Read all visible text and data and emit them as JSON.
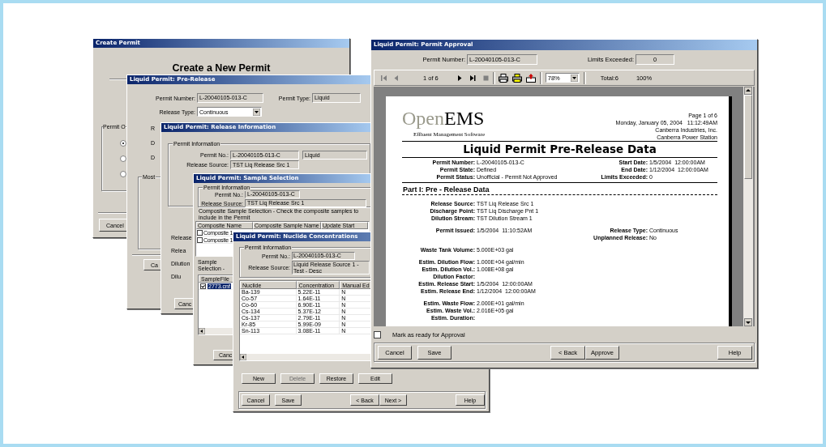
{
  "windows": [
    {
      "kind": "create",
      "title": "Create Permit",
      "heading": "Create a New Permit",
      "group_label": "Permit O",
      "options": [
        {
          "selected": true
        },
        {
          "selected": false
        },
        {
          "selected": false
        }
      ],
      "buttons": [
        "Cancel"
      ]
    },
    {
      "kind": "prerelease",
      "title": "Liquid Permit: Pre-Release",
      "fields": [
        {
          "label": "Permit Number:",
          "value": "L-20040105-013-C"
        },
        {
          "label": "Permit Type:",
          "value": "Liquid"
        }
      ],
      "release_type": {
        "label": "Release Type:",
        "value": "Continuous"
      },
      "labels": [
        "R",
        "D",
        "D"
      ],
      "group_label": "Most",
      "buttons": [
        "Ca"
      ]
    },
    {
      "kind": "release_info",
      "title": "Liquid Permit: Release Information",
      "group_label": "Permit Information",
      "fields": [
        {
          "label": "Permit No.:",
          "values": [
            "L-20040105-013-C",
            "Liquid"
          ]
        },
        {
          "label": "Release Source:",
          "values": [
            "TST Liq Release Src 1"
          ]
        }
      ],
      "labels": [
        "Release",
        "Relea",
        "Dilution",
        "Dilu"
      ],
      "buttons": [
        "Canc"
      ]
    },
    {
      "kind": "sample_selection",
      "title": "Liquid Permit: Sample Selection",
      "group_label": "Permit Information",
      "fields": [
        {
          "label": "Permit No.:",
          "values": [
            "L-20040105-013-C"
          ]
        },
        {
          "label": "Release Source:",
          "values": [
            "TST Liq Release Src 1"
          ]
        }
      ],
      "instruction": "Composite Sample Selection - Check the composite samples to include in the Permit",
      "composite_columns": [
        "Composite Name",
        "Composite Sample Name",
        "Update Start"
      ],
      "composite_rows": [
        {
          "checked": false,
          "name": "Composite 1"
        },
        {
          "checked": false,
          "name": "Composite 1"
        }
      ],
      "sample_label": "Sample Selection -",
      "sample_columns": [
        "SampleFile"
      ],
      "sample_rows": [
        {
          "checked": true,
          "selected": true,
          "name": "2773.cnf"
        }
      ],
      "buttons": [
        "Canc"
      ]
    },
    {
      "kind": "nuclides",
      "title": "Liquid Permit: Nuclide Concentrations",
      "group_label": "Permit Information",
      "fields": [
        {
          "label": "Permit No.:",
          "values": [
            "L-20040105-013-C"
          ]
        },
        {
          "label": "Release Source:",
          "values": [
            "Liquid Release Source 1 - Test - Desc"
          ]
        }
      ],
      "columns": [
        "Nuclide",
        "Concentration",
        "Manual Ed"
      ],
      "rows": [
        [
          "Ba-139",
          "5.22E-11",
          "N"
        ],
        [
          "Co-57",
          "1.64E-11",
          "N"
        ],
        [
          "Co-60",
          "6.90E-11",
          "N"
        ],
        [
          "Cs-134",
          "5.37E-12",
          "N"
        ],
        [
          "Cs-137",
          "2.79E-11",
          "N"
        ],
        [
          "Kr-85",
          "5.99E-09",
          "N"
        ],
        [
          "Sn-113",
          "3.08E-11",
          "N"
        ]
      ],
      "actions": [
        {
          "label": "New",
          "disabled": false
        },
        {
          "label": "Delete",
          "disabled": true
        },
        {
          "label": "Restore",
          "disabled": false
        },
        {
          "label": "Edit",
          "disabled": false
        }
      ],
      "nav_buttons": [
        "Cancel",
        "Save",
        "< Back",
        "Next >",
        "Help"
      ]
    },
    {
      "kind": "approval",
      "title": "Liquid Permit: Permit Approval",
      "permit_number": {
        "label": "Permit Number:",
        "value": "L-20040105-013-C"
      },
      "limits_exceeded": {
        "label": "Limits Exceeded:",
        "value": "0"
      },
      "toolbar": {
        "page": "1 of 6",
        "zoom": "78%",
        "total": "Total:6",
        "percent": "100%"
      },
      "report": {
        "logo": {
          "light": "Open",
          "dark": "EMS",
          "tagline": "Effluent Management Software"
        },
        "header_lines": [
          "Page 1 of 6",
          "Monday, January 05, 2004   11:12:49AM",
          "Canberra Industries, Inc.",
          "Canberra Power Station"
        ],
        "title": "Liquid Permit Pre-Release Data",
        "info": [
          {
            "left": {
              "label": "Permit Number:",
              "value": "L-20040105-013-C"
            },
            "right": {
              "label": "Start Date:",
              "value": "1/5/2004  12:00:00AM"
            }
          },
          {
            "left": {
              "label": "Permit State:",
              "value": "Defined"
            },
            "right": {
              "label": "End Date:",
              "value": "1/12/2004  12:00:00AM"
            }
          },
          {
            "left": {
              "label": "Permit Status:",
              "value": "Unofficial - Permit Not Approved"
            },
            "right": {
              "label": "Limits Exceeded:",
              "value": "0"
            }
          }
        ],
        "part_title": "Part I: Pre - Release Data",
        "groups": [
          [
            {
              "left": {
                "label": "Release Source:",
                "value": "TST Liq Release Src 1"
              }
            },
            {
              "left": {
                "label": "Discharge Point:",
                "value": "TST Liq Discharge Pnt 1"
              }
            },
            {
              "left": {
                "label": "Dilution Stream:",
                "value": "TST Dilution Stream 1"
              }
            }
          ],
          [
            {
              "left": {
                "label": "Permit Issued:",
                "value": "1/5/2004  11:10:52AM"
              },
              "right": {
                "label": "Release Type:",
                "value": "Continuous"
              }
            },
            {
              "right": {
                "label": "Unplanned Release:",
                "value": "No"
              }
            }
          ],
          [
            {
              "left": {
                "label": "Waste Tank Volume:",
                "value": "5.000E+03 gal"
              }
            }
          ],
          [
            {
              "left": {
                "label": "Estim. Dilution Flow:",
                "value": "1.000E+04 gal/min"
              }
            },
            {
              "left": {
                "label": "Estim. Dilution Vol.:",
                "value": "1.008E+08 gal"
              }
            },
            {
              "left": {
                "label": "Dilution Factor:"
              }
            },
            {
              "left": {
                "label": "Estim. Release Start:",
                "value": "1/5/2004  12:00:00AM"
              }
            },
            {
              "left": {
                "label": "Estim. Release End:",
                "value": "1/12/2004  12:00:00AM"
              }
            }
          ],
          [
            {
              "left": {
                "label": "Estim. Waste Flow:",
                "value": "2.000E+01 gal/min"
              }
            },
            {
              "left": {
                "label": "Estim. Waste Vol.:",
                "value": "2.016E+05 gal"
              }
            },
            {
              "left": {
                "label": "Estim. Duration:"
              }
            }
          ]
        ]
      },
      "approval_checkbox": {
        "label": "Mark as ready for Approval",
        "checked": false
      },
      "buttons": [
        "Cancel",
        "Save",
        "< Back",
        "Approve",
        "Help"
      ]
    }
  ]
}
